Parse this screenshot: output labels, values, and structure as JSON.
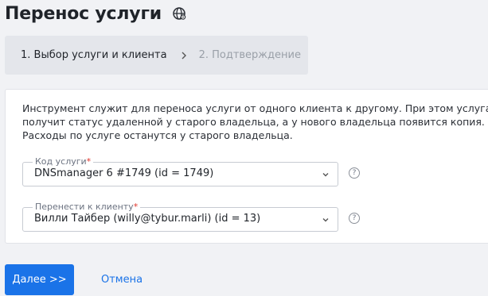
{
  "page": {
    "title": "Перенос услуги"
  },
  "steps": [
    {
      "label": "1. Выбор услуги и клиента",
      "active": true
    },
    {
      "label": "2. Подтверждение",
      "active": false
    }
  ],
  "form": {
    "info": "Инструмент служит для переноса услуги от одного клиента к другому. При этом услуга получит статус удаленной у старого владельца, а у нового владельца появится копия. Расходы по услуге останутся у старого владельца.",
    "service_field": {
      "label": "Код услуги",
      "required_mark": "*",
      "value": "DNSmanager 6 #1749 (id = 1749)"
    },
    "client_field": {
      "label": "Перенести к клиенту",
      "required_mark": "*",
      "value": "Вилли Тайбер (willy@tybur.marli) (id = 13)"
    },
    "help_glyph": "?"
  },
  "actions": {
    "next_label": "Далее >>",
    "cancel_label": "Отмена"
  },
  "colors": {
    "primary": "#1a73e8",
    "required": "#e0342b",
    "background": "#f1f2f5"
  },
  "icons": {
    "title_icon": "globe-icon",
    "step_separator": "chevron-right-icon",
    "select_arrow": "chevron-down-icon",
    "help": "help-icon"
  }
}
